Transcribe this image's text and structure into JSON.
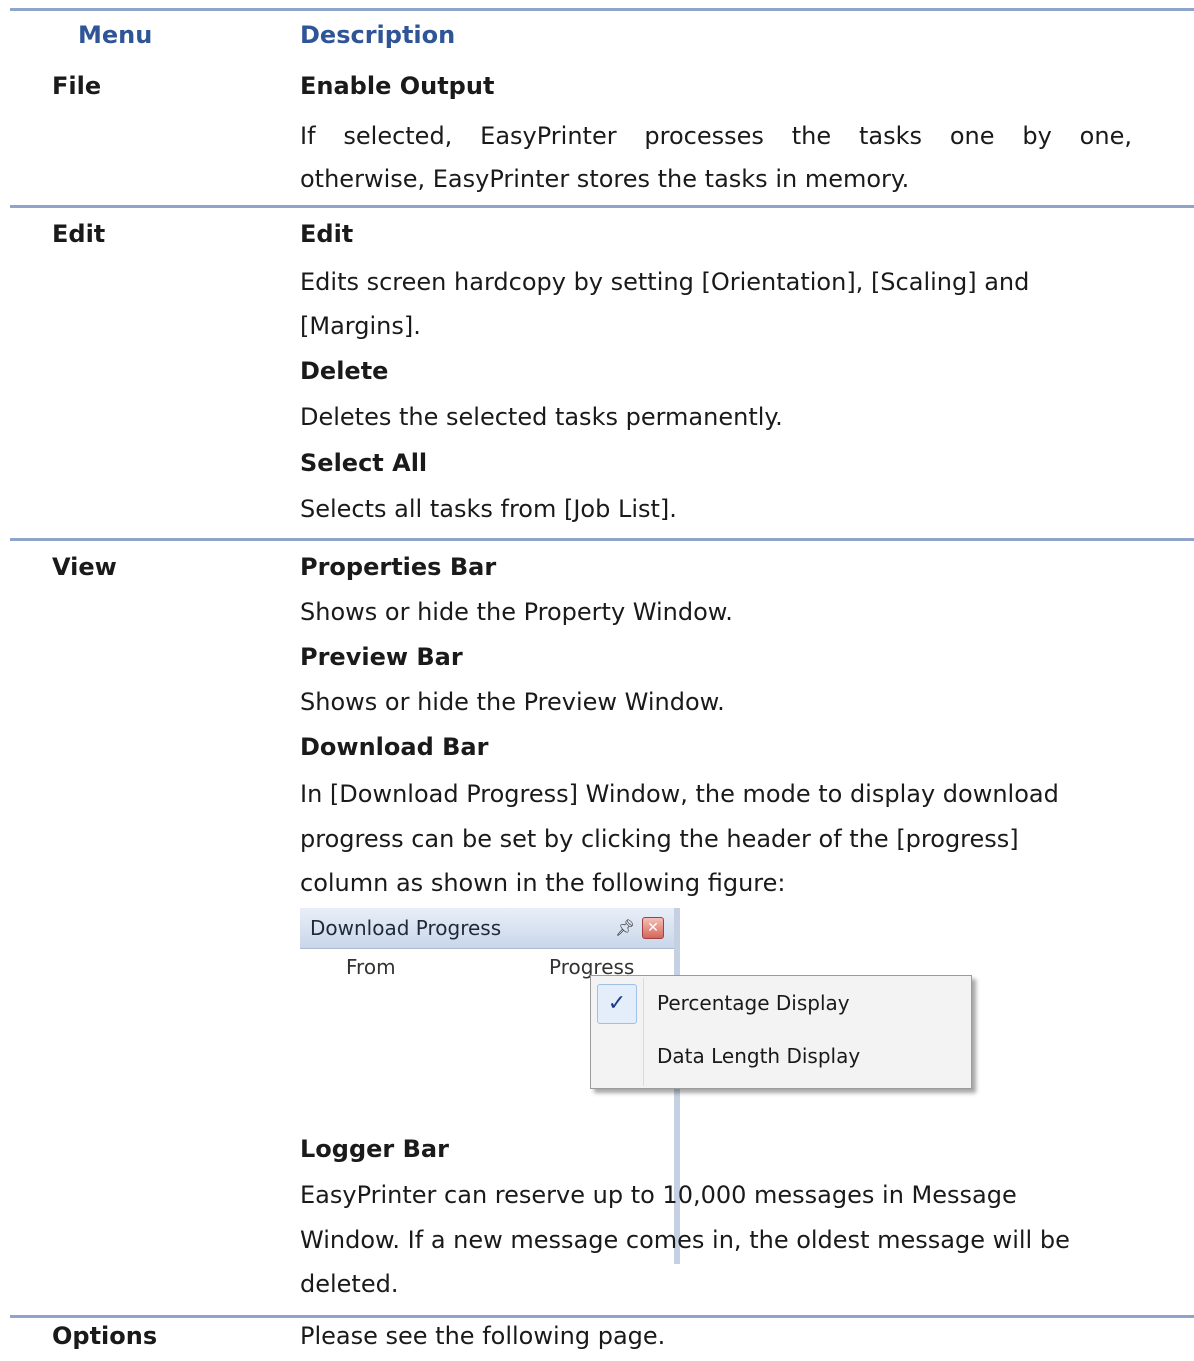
{
  "header": {
    "menu": "Menu",
    "description": "Description"
  },
  "file": {
    "menu": "File",
    "items": [
      {
        "title": "Enable Output",
        "line1": [
          "If",
          "selected,",
          "EasyPrinter",
          "processes",
          "the",
          "tasks",
          "one",
          "by",
          "one,"
        ],
        "line2": "otherwise, EasyPrinter stores the tasks in memory."
      }
    ]
  },
  "edit": {
    "menu": "Edit",
    "edit_title": "Edit",
    "edit_desc_1": "Edits screen hardcopy by setting [Orientation], [Scaling] and",
    "edit_desc_2": "[Margins].",
    "delete_title": "Delete",
    "delete_desc": "Deletes the selected tasks permanently.",
    "selectall_title": "Select All",
    "selectall_desc": "Selects all tasks from [Job List]."
  },
  "view": {
    "menu": "View",
    "properties_title": "Properties Bar",
    "properties_desc": "Shows or hide the Property Window.",
    "preview_title": "Preview Bar",
    "preview_desc": "Shows or hide the Preview Window.",
    "download_title": "Download Bar",
    "download_desc_1": "In [Download Progress] Window, the mode to display download",
    "download_desc_2": "progress can be set by clicking the header of the [progress]",
    "download_desc_3": "column as shown in the following figure:",
    "figure": {
      "window_title": "Download Progress",
      "col_from": "From",
      "col_progress": "Progress",
      "menu_item_1": "Percentage Display",
      "menu_item_2": "Data Length Display"
    },
    "logger_title": "Logger Bar",
    "logger_desc_1": "EasyPrinter can reserve up to 10,000 messages in Message",
    "logger_desc_2": "Window. If a new message comes in, the oldest message will be",
    "logger_desc_3": "deleted."
  },
  "options": {
    "menu": "Options",
    "desc": "Please see the following page."
  },
  "colors": {
    "header_text": "#2f5597",
    "rule": "#8ea4c8"
  }
}
